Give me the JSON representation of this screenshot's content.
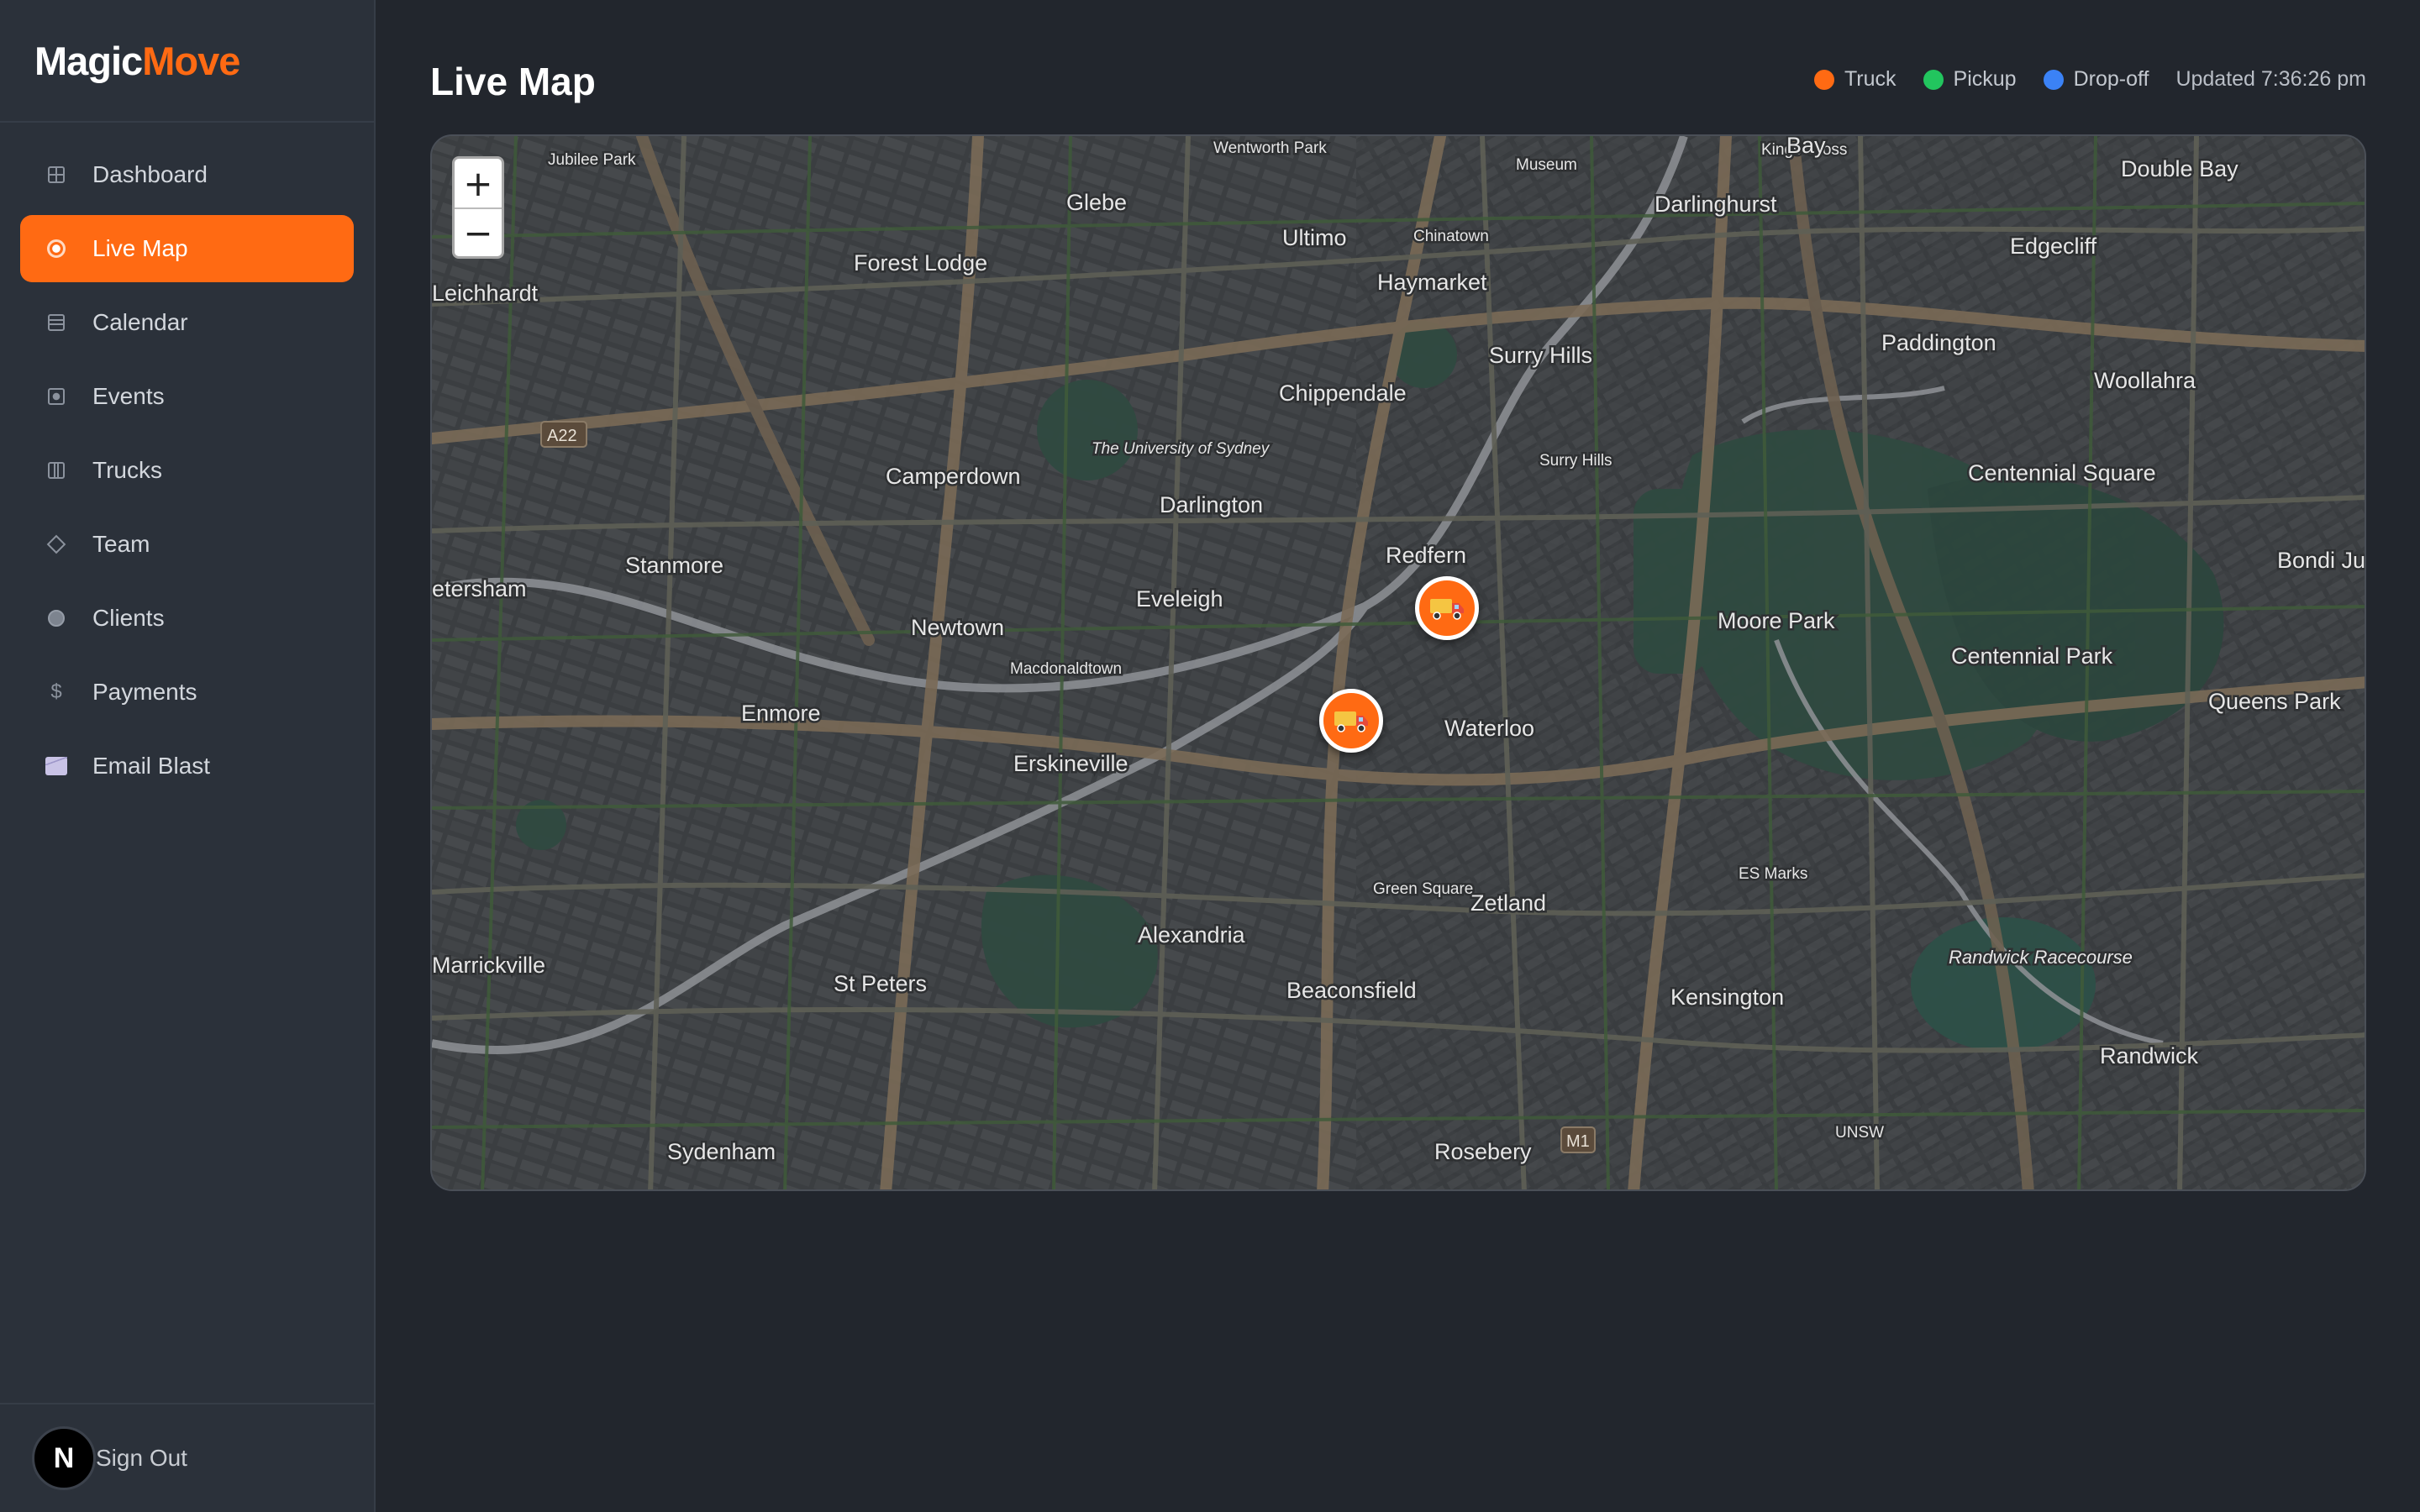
{
  "brand": {
    "part1": "Magic",
    "part2": "Move"
  },
  "nav": {
    "items": [
      {
        "label": "Dashboard",
        "icon": "grid-icon"
      },
      {
        "label": "Live Map",
        "icon": "location-icon",
        "active": true
      },
      {
        "label": "Calendar",
        "icon": "calendar-icon"
      },
      {
        "label": "Events",
        "icon": "events-icon"
      },
      {
        "label": "Trucks",
        "icon": "trucks-icon"
      },
      {
        "label": "Team",
        "icon": "team-icon"
      },
      {
        "label": "Clients",
        "icon": "clients-icon"
      },
      {
        "label": "Payments",
        "icon": "dollar-icon"
      },
      {
        "label": "Email Blast",
        "icon": "envelope-icon"
      }
    ]
  },
  "user": {
    "initial": "N",
    "signout_label": "Sign Out"
  },
  "header": {
    "title": "Live Map",
    "updated": "Updated 7:36:26 pm"
  },
  "legend": [
    {
      "label": "Truck",
      "color": "#ff6a13"
    },
    {
      "label": "Pickup",
      "color": "#22c55e"
    },
    {
      "label": "Drop-off",
      "color": "#3b82f6"
    }
  ],
  "map": {
    "zoom_in": "+",
    "zoom_out": "−",
    "labels": {
      "glebe": "Glebe",
      "ultimo": "Ultimo",
      "forest_lodge": "Forest Lodge",
      "haymarket": "Haymarket",
      "chinatown": "Chinatown",
      "darlinghurst": "Darlinghurst",
      "edgecliff": "Edgecliff",
      "paddington": "Paddington",
      "woollahra": "Woollahra",
      "leichhardt": "Leichhardt",
      "surry_hills": "Surry Hills",
      "chippendale": "Chippendale",
      "camperdown": "Camperdown",
      "university": "The University of Sydney",
      "darlington": "Darlington",
      "centennial_square": "Centennial Square",
      "stanmore": "Stanmore",
      "petersham": "etersham",
      "redfern": "Redfern",
      "eveleigh": "Eveleigh",
      "newtown": "Newtown",
      "moore_park": "Moore Park",
      "centennial_park": "Centennial Park",
      "bondi_junction": "Bondi Junc",
      "queens_park": "Queens Park",
      "enmore": "Enmore",
      "waterloo": "Waterloo",
      "erskineville": "Erskineville",
      "zetland": "Zetland",
      "alexandria": "Alexandria",
      "marrickville": "Marrickville",
      "st_peters": "St Peters",
      "beaconsfield": "Beaconsfield",
      "kensington": "Kensington",
      "randwick": "Randwick",
      "sydenham": "Sydenham",
      "rosebery": "Rosebery",
      "double_bay": "Double Bay",
      "randwick_racecourse": "Randwick Racecourse",
      "macdonaldtown": "Macdonaldtown",
      "green_square": "Green Square",
      "a22": "A22",
      "m1": "M1",
      "jubilee_park": "Jubilee Park",
      "wentworth_park": "Wentworth Park",
      "kings_cross": "Kings Cross",
      "bay": "Bay",
      "museum": "Museum",
      "es_marks": "ES Marks",
      "unsw": "UNSW",
      "moore_park_road": "Surry Hills"
    }
  }
}
